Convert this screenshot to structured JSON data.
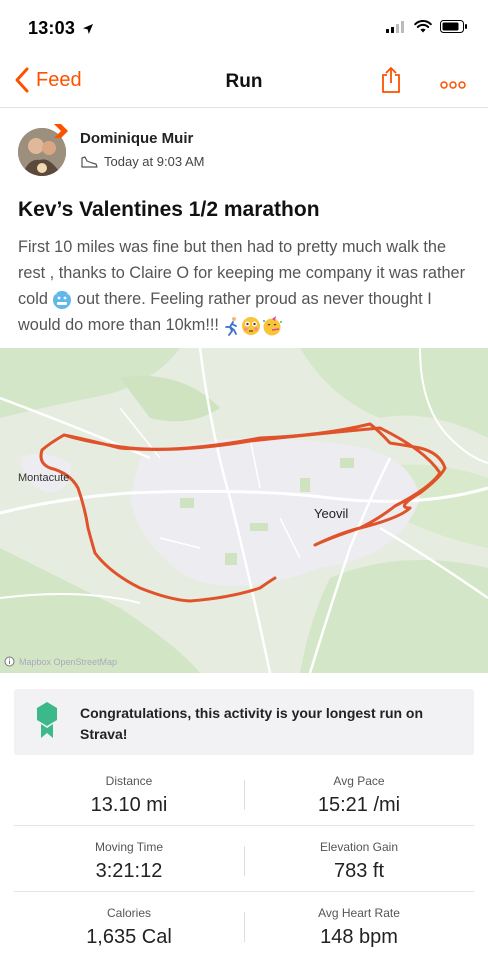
{
  "status_bar": {
    "time": "13:03"
  },
  "nav": {
    "back_label": "Feed",
    "title": "Run",
    "accent_color": "#fc5200"
  },
  "athlete": {
    "name": "Dominique Muir",
    "timestamp": "Today at 9:03 AM"
  },
  "activity": {
    "title": "Kev’s Valentines 1/2 marathon",
    "description_part1": "First 10 miles was fine but then had to pretty much walk the rest , thanks to Claire O for keeping me company it was rather cold ",
    "description_part2": " out there. Feeling rather proud as never thought I would do more than 10km!!! ",
    "route_color": "#e0522a"
  },
  "map": {
    "labels": {
      "town_west": "Montacute",
      "town_east": "Yeovil"
    },
    "credit": "Mapbox OpenStreetMap"
  },
  "achievement": {
    "text": "Congratulations, this activity is your longest run on Strava!",
    "badge_color": "#3cb98a"
  },
  "stats": [
    {
      "left": {
        "label": "Distance",
        "value": "13.10 mi"
      },
      "right": {
        "label": "Avg Pace",
        "value": "15:21 /mi"
      }
    },
    {
      "left": {
        "label": "Moving Time",
        "value": "3:21:12"
      },
      "right": {
        "label": "Elevation Gain",
        "value": "783 ft"
      }
    },
    {
      "left": {
        "label": "Calories",
        "value": "1,635 Cal"
      },
      "right": {
        "label": "Avg Heart Rate",
        "value": "148 bpm"
      }
    }
  ]
}
